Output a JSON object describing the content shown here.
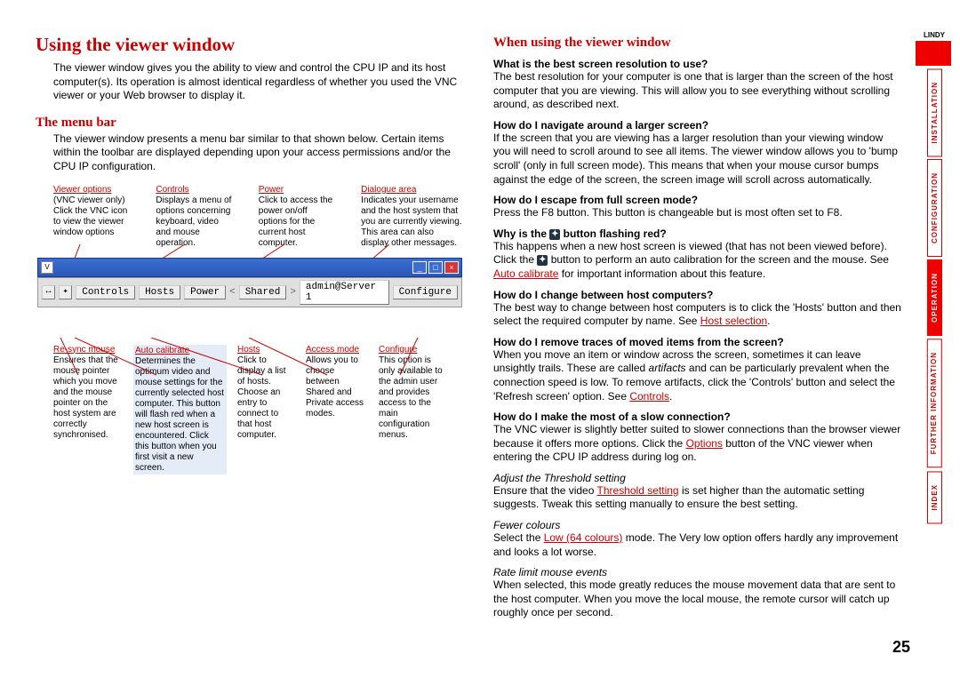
{
  "brand": "LINDY",
  "pageNumber": "25",
  "nav": {
    "installation": "INSTALLATION",
    "configuration": "CONFIGURATION",
    "operation": "OPERATION",
    "further": "FURTHER INFORMATION",
    "index": "INDEX"
  },
  "left": {
    "title": "Using the viewer window",
    "intro": "The viewer window gives you the ability to view and control the CPU IP and its host computer(s). Its operation is almost identical regardless of whether you used the VNC viewer or your Web browser to display it.",
    "menubar_h": "The menu bar",
    "menubar_p": "The viewer window presents a menu bar similar to that shown below. Certain items within the toolbar are displayed depending upon your access permissions and/or the CPU IP configuration.",
    "annTop": [
      {
        "t": "Viewer options",
        "d": "(VNC viewer only) Click the VNC icon to view the viewer window options"
      },
      {
        "t": "Controls",
        "d": "Displays a menu of options concerning keyboard, video and mouse operation."
      },
      {
        "t": "Power",
        "d": "Click to access the power on/off options for the current host computer."
      },
      {
        "t": "Dialogue area",
        "d": "Indicates your username and the host system that you are currently viewing. This area can also display other messages."
      }
    ],
    "toolbar": {
      "controls": "Controls",
      "hosts": "Hosts",
      "power": "Power",
      "shared": "Shared",
      "admin": "admin@Server 1",
      "configure": "Configure"
    },
    "annBot": [
      {
        "t": "Re-sync mouse",
        "d": "Ensures that the mouse pointer which you move and the mouse pointer on the host system are correctly synchronised.",
        "hl": false
      },
      {
        "t": "Auto calibrate",
        "d": "Determines the optimum video and mouse settings for the currently selected host computer. This button will flash red when a new host screen is encountered. Click this button when you first visit a new screen.",
        "hl": true
      },
      {
        "t": "Hosts",
        "d": "Click to display a list of hosts. Choose an entry to connect to that host computer.",
        "hl": false
      },
      {
        "t": "Access mode",
        "d": "Allows you to choose between Shared and Private access modes.",
        "hl": false
      },
      {
        "t": "Configure",
        "d": "This option is only available to the admin user and provides access to the main configuration menus.",
        "hl": false
      }
    ]
  },
  "right": {
    "title": "When using the viewer window",
    "qa": [
      {
        "q": "What is the best screen resolution to use?",
        "a": "The best resolution for your computer is one that is larger than the screen of the host computer that you are viewing. This will allow you to see everything without scrolling around, as described next."
      },
      {
        "q": "How do I navigate around a larger screen?",
        "a": "If the screen that you are viewing has a larger resolution than your viewing window you will need to scroll around to see all items. The viewer window allows you to 'bump scroll' (only in full screen mode). This means that when your mouse cursor bumps against the edge of the screen, the screen image will scroll across automatically."
      },
      {
        "q": "How do I escape from full screen mode?",
        "a": "Press the F8 button. This button is changeable but is most often set to F8."
      }
    ],
    "q4_pre": "Why is the ",
    "q4_post": " button flashing red?",
    "q4_a_pre": "This happens when a new host screen is viewed (that has not been viewed before). Click the ",
    "q4_a_mid": " button to perform an auto calibration for the screen and the mouse. See ",
    "q4_link": "Auto calibrate",
    "q4_a_end": " for important information about this feature.",
    "q5": "How do I change between host computers?",
    "q5_a_pre": "The best way to change between host computers is to click the 'Hosts' button and then select the required computer by name. See ",
    "q5_link": "Host selection",
    "q5_a_end": ".",
    "q6": "How do I remove traces of moved items from the screen?",
    "q6_a_pre": "When you move an item or window across the screen, sometimes it can leave unsightly trails. These are called ",
    "q6_artifacts": "artifacts",
    "q6_a_mid": " and can be particularly prevalent when the connection speed is low. To remove artifacts, click the 'Controls' button and select the 'Refresh screen' option. See ",
    "q6_link": "Controls",
    "q6_a_end": ".",
    "q7": "How do I make the most of a slow connection?",
    "q7_a_pre": "The VNC viewer is slightly better suited to slower connections than the browser viewer because it offers more options. Click the ",
    "q7_link": "Options",
    "q7_a_end": " button of the VNC viewer when entering the CPU IP address during log on.",
    "s1_h": "Adjust the Threshold setting",
    "s1_pre": "Ensure that the video ",
    "s1_link": "Threshold setting",
    "s1_end": " is set higher than the automatic setting suggests. Tweak this setting manually to ensure the best setting.",
    "s2_h": "Fewer colours",
    "s2_pre": "Select the ",
    "s2_link": "Low (64 colours)",
    "s2_end": " mode. The Very low option offers hardly any improvement and looks a lot worse.",
    "s3_h": "Rate limit mouse events",
    "s3": "When selected, this mode greatly reduces the mouse movement data that are sent to the host computer. When you move the local mouse, the remote cursor will catch up roughly once per second."
  }
}
